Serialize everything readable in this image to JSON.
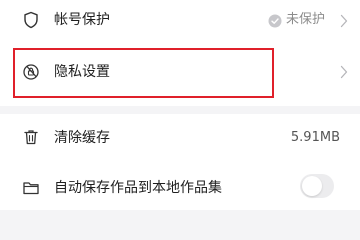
{
  "settings": {
    "account_protection": {
      "label": "帐号保护",
      "icon": "shield-icon",
      "status": "未保护",
      "status_icon": "check-circle-icon"
    },
    "privacy": {
      "label": "隐私设置",
      "icon": "privacy-lock-icon"
    },
    "clear_cache": {
      "label": "清除缓存",
      "icon": "trash-icon",
      "size": "5.91MB"
    },
    "autosave": {
      "label": "自动保存作品到本地作品集",
      "icon": "folder-icon",
      "enabled": false
    }
  },
  "colors": {
    "highlight": "#e0202a",
    "section_gap": "#f4f4f6",
    "toggle_off": "#ececee"
  }
}
